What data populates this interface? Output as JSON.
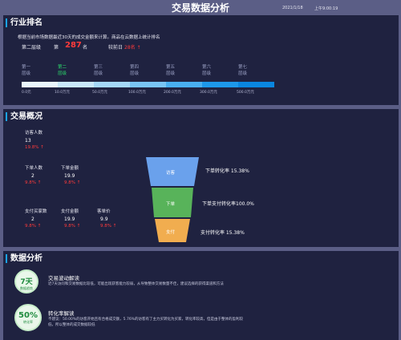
{
  "header": {
    "title": "交易数据分析",
    "date": "2021/1/18",
    "time": "上午9:00:19"
  },
  "industry": {
    "section_title": "行业排名",
    "description": "根据当前市场数据最近30天的成交金额来计算。商品在云数据上统计排名",
    "level_label": "第二层级",
    "rank_prefix": "第",
    "rank_value": "287",
    "rank_suffix": "名",
    "compare_label": "较前日",
    "compare_value": "28名 ↑",
    "tiers": [
      {
        "line1": "第一",
        "line2": "层级"
      },
      {
        "line1": "第二",
        "line2": "层级"
      },
      {
        "line1": "第三",
        "line2": "层级"
      },
      {
        "line1": "第四",
        "line2": "层级"
      },
      {
        "line1": "第五",
        "line2": "层级"
      },
      {
        "line1": "第六",
        "line2": "层级"
      },
      {
        "line1": "第七",
        "line2": "层级"
      }
    ],
    "active_tier": 1,
    "tier_colors": [
      "#e9f5fd",
      "#c9e8fb",
      "#a5d8f8",
      "#79c5f4",
      "#49aff0",
      "#1d98ea",
      "#0a86e0"
    ],
    "ticks": [
      "0.0元",
      "10.0万元",
      "50.0万元",
      "100.0万元",
      "200.0万元",
      "300.0万元",
      "500.0万元"
    ]
  },
  "overview": {
    "section_title": "交易概况",
    "visitors": {
      "label": "访客人数",
      "value": "13",
      "change": "19.8% ↑"
    },
    "order_people": {
      "label": "下单人数",
      "value": "2",
      "change": "9.8% ↑"
    },
    "order_amount": {
      "label": "下单金额",
      "value": "19.9",
      "change": "9.8% ↑"
    },
    "buyers": {
      "label": "支付买家数",
      "value": "2",
      "change": "9.8% ↑"
    },
    "pay_amount": {
      "label": "支付金额",
      "value": "19.9",
      "change": "9.8% ↑"
    },
    "unit_price": {
      "label": "客单价",
      "value": "9.9",
      "change": "9.8% ↑"
    },
    "funnel": {
      "stages": [
        "访客",
        "下单",
        "支付"
      ],
      "colors": [
        "#6aa1ec",
        "#58b35a",
        "#f1ad4f"
      ],
      "rates": [
        "下单转化率 15.38%",
        "下单支付转化率100.0%",
        "支付转化率 15.38%"
      ]
    }
  },
  "analysis": {
    "section_title": "数据分析",
    "items": [
      {
        "badge_big": "7天",
        "badge_small": "数据趋势",
        "title": "交易波动解读",
        "body": "近7天访问和交易数据比较低，可能出现获客能力较弱，从导致整体交易数量不佳，建议选择的获得渠道和方法"
      },
      {
        "badge_big": "50%",
        "badge_small": "转化率",
        "title": "转化率解读",
        "body": "不建议：50.00%的访客开始且有合格成交额，5.76%的访客有了主力买转化为买家，转化率较高，但是由于整体的盈利较低，所以整体的成交数据较低"
      }
    ]
  }
}
